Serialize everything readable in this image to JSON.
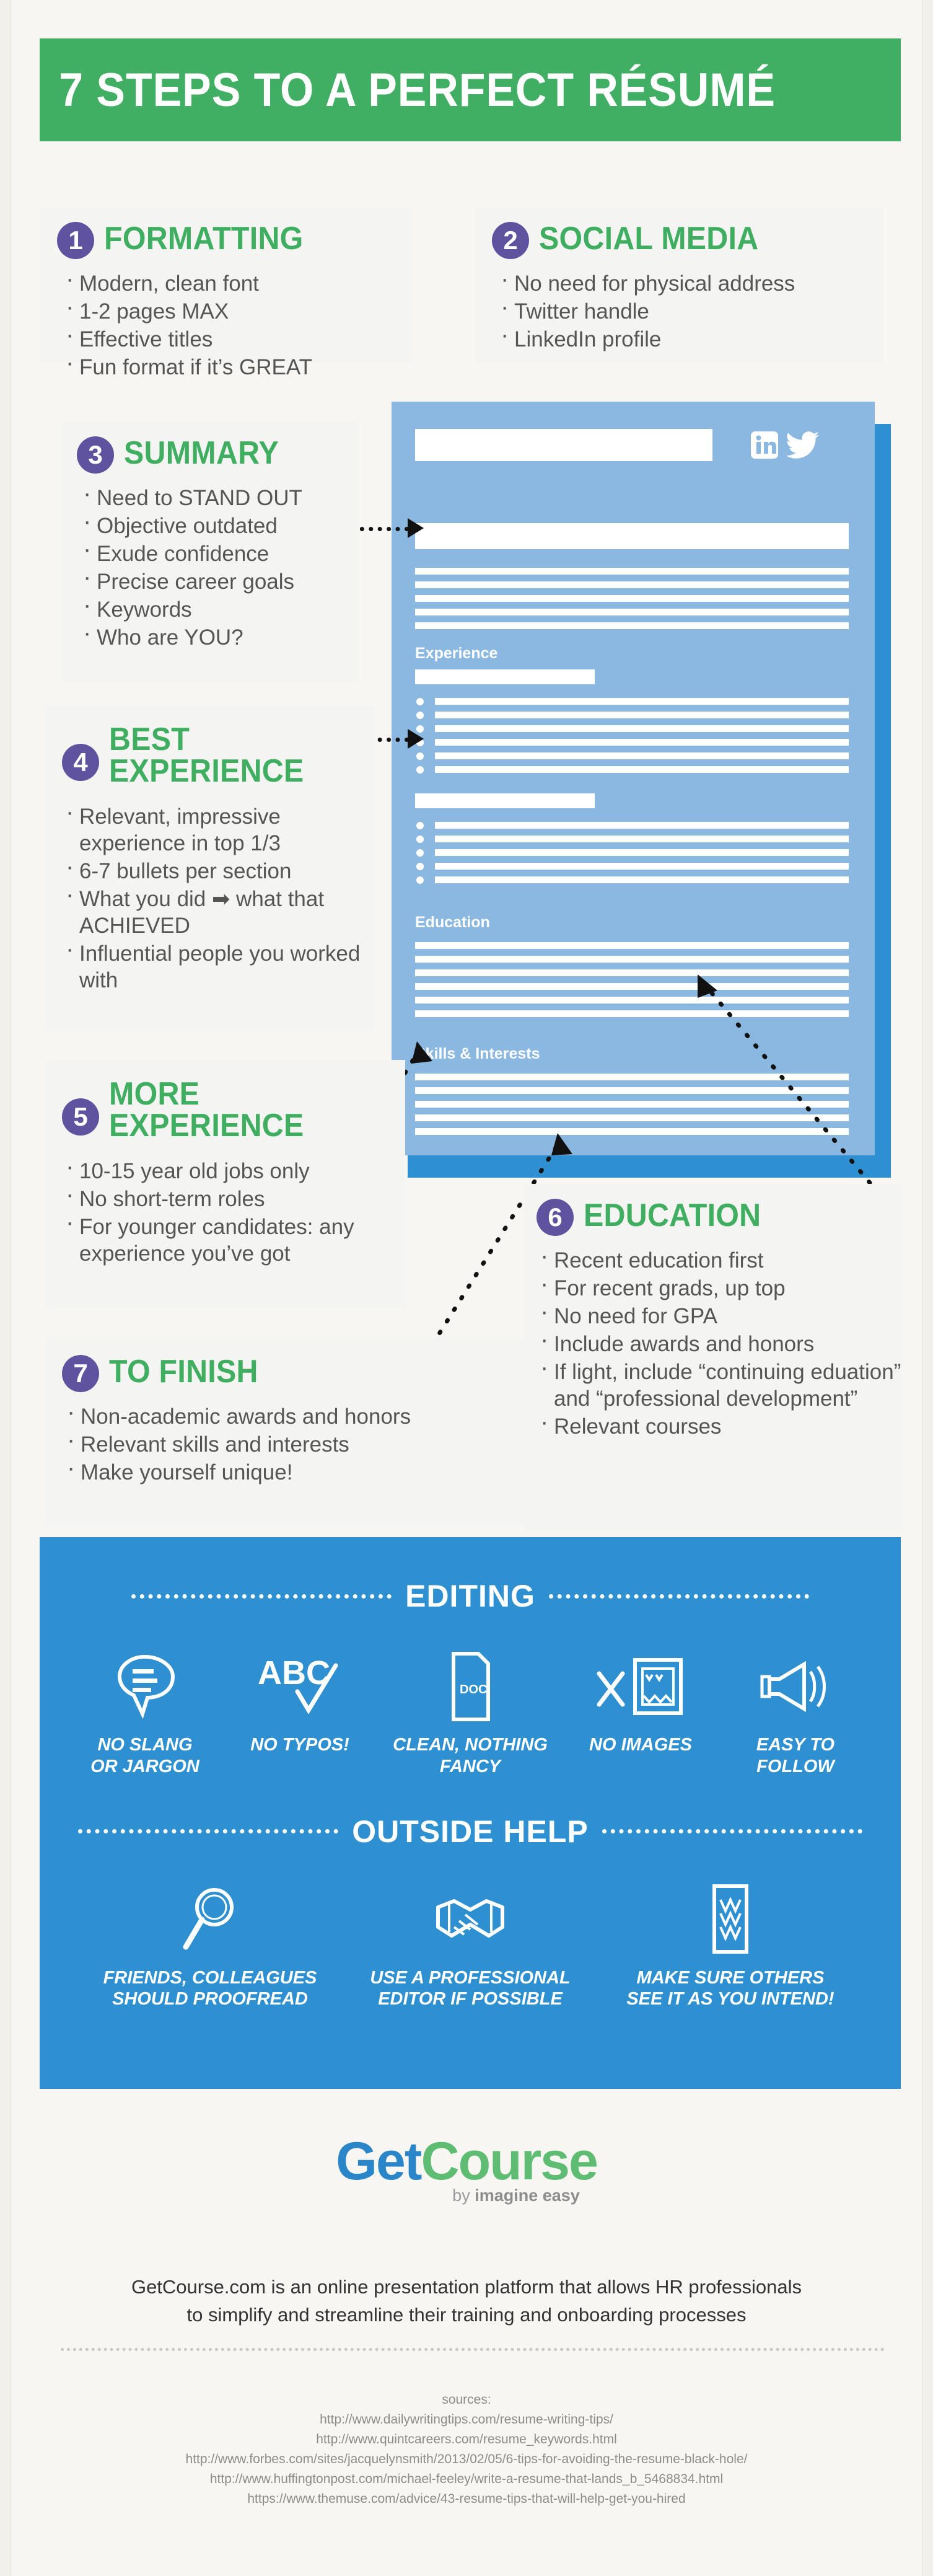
{
  "header": {
    "title": "7 STEPS TO A PERFECT RÉSUMÉ"
  },
  "colors": {
    "green": "#41af63",
    "purple": "#5f539f",
    "blue": "#2e90d0",
    "light_blue": "#8ab8e0",
    "page_bg": "#f7f6f2",
    "card_bg": "#f4f4f2"
  },
  "steps": [
    {
      "number": "1",
      "title": "FORMATTING",
      "bullets": [
        "Modern, clean font",
        "1-2 pages MAX",
        "Effective titles",
        "Fun format if it’s GREAT"
      ]
    },
    {
      "number": "2",
      "title": "SOCIAL MEDIA",
      "bullets": [
        "No need for physical address",
        "Twitter handle",
        "LinkedIn profile"
      ]
    },
    {
      "number": "3",
      "title": "SUMMARY",
      "bullets": [
        "Need to STAND OUT",
        "Objective outdated",
        "Exude confidence",
        "Precise career goals",
        "Keywords",
        "Who are YOU?"
      ]
    },
    {
      "number": "4",
      "title": "BEST\nEXPERIENCE",
      "bullets": [
        "Relevant, impressive experience in top 1/3",
        "6-7 bullets per section",
        "What you did ➡ what that ACHIEVED",
        "Influential people you worked with"
      ]
    },
    {
      "number": "5",
      "title": "MORE\nEXPERIENCE",
      "bullets": [
        "10-15 year old jobs only",
        "No short-term roles",
        "For younger candidates: any experience you’ve got"
      ]
    },
    {
      "number": "6",
      "title": "EDUCATION",
      "bullets": [
        "Recent education first",
        "For recent grads, up top",
        "No need for GPA",
        "Include awards and honors",
        "If light, include “continuing eduation” and “professional development”",
        "Relevant courses"
      ]
    },
    {
      "number": "7",
      "title": "TO FINISH",
      "bullets": [
        "Non-academic awards and honors",
        "Relevant skills and interests",
        "Make yourself unique!"
      ]
    }
  ],
  "resume_mock": {
    "sections": [
      "Experience",
      "Education",
      "Skills & Interests"
    ],
    "social_icons": [
      "linkedin-icon",
      "twitter-icon"
    ]
  },
  "editing": {
    "heading": "EDITING",
    "items": [
      {
        "icon": "speech-bubble-icon",
        "caption": "NO SLANG\nOR JARGON"
      },
      {
        "icon": "abc-check-icon",
        "caption": "NO TYPOS!",
        "label": "ABC"
      },
      {
        "icon": "doc-icon",
        "caption": "CLEAN, NOTHING\nFANCY",
        "label": "DOC"
      },
      {
        "icon": "no-image-icon",
        "caption": "NO IMAGES"
      },
      {
        "icon": "megaphone-icon",
        "caption": "EASY TO\nFOLLOW"
      }
    ]
  },
  "outside_help": {
    "heading": "OUTSIDE HELP",
    "items": [
      {
        "icon": "magnifier-icon",
        "caption": "FRIENDS, COLLEAGUES\nSHOULD PROOFREAD"
      },
      {
        "icon": "handshake-icon",
        "caption": "USE A PROFESSIONAL\nEDITOR IF POSSIBLE"
      },
      {
        "icon": "document-scan-icon",
        "caption": "MAKE SURE OTHERS\nSEE IT AS YOU INTEND!"
      }
    ]
  },
  "footer": {
    "logo_part1": "Get",
    "logo_part2": "Course",
    "logo_by_prefix": "by",
    "logo_by_brand": "imagine easy",
    "tagline": "GetCourse.com is an online presentation platform that allows HR professionals\nto simplify and streamline their training and onboarding processes",
    "sources_label": "sources:",
    "sources": [
      "http://www.dailywritingtips.com/resume-writing-tips/",
      "http://www.quintcareers.com/resume_keywords.html",
      "http://www.forbes.com/sites/jacquelynsmith/2013/02/05/6-tips-for-avoiding-the-resume-black-hole/",
      "http://www.huffingtonpost.com/michael-feeley/write-a-resume-that-lands_b_5468834.html",
      "https://www.themuse.com/advice/43-resume-tips-that-will-help-get-you-hired"
    ]
  }
}
